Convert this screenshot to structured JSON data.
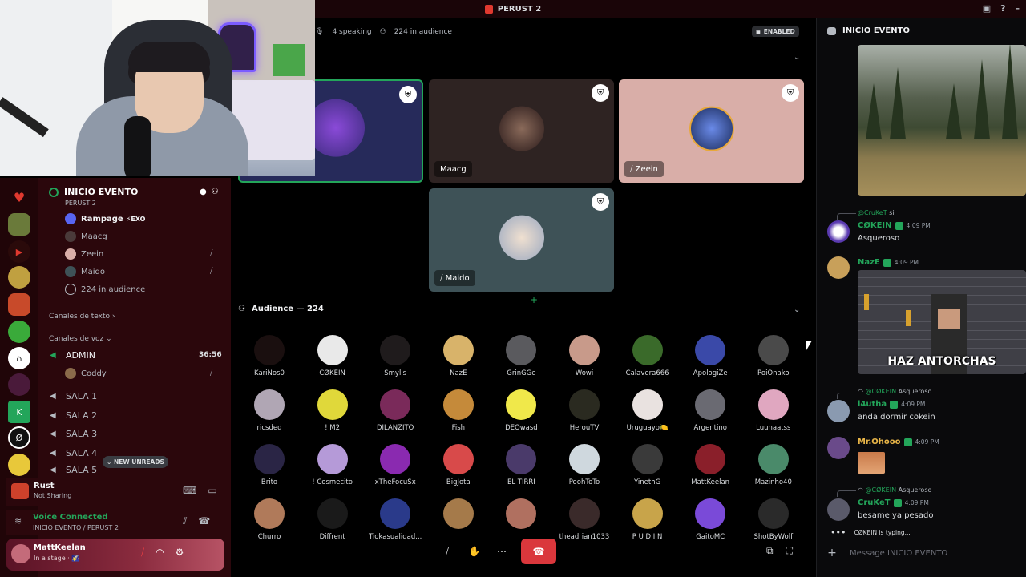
{
  "window": {
    "title": "PERUST 2",
    "accent": "#e0392f"
  },
  "stage": {
    "speaking": "4 speaking",
    "audience_count": "224 in audience",
    "status_badge": "ENABLED",
    "speakers": [
      {
        "name": "Rampage",
        "label": "",
        "bg": "#262a5a",
        "highlight": true
      },
      {
        "name": "Maacg",
        "label": "Maacg",
        "bg": "#2e2322"
      },
      {
        "name": "Zeein",
        "label": "Zeein",
        "bg": "#d9aea8",
        "muted": true
      },
      {
        "name": "Maido",
        "label": "Maido",
        "bg": "#3e5257",
        "muted": true
      }
    ],
    "audience_header": "Audience — 224",
    "audience": [
      {
        "name": "KariÑos0",
        "color": "#1a0f0f"
      },
      {
        "name": "CØKEIN",
        "color": "#e9e9e9"
      },
      {
        "name": "Smylls",
        "color": "#1f1b1c"
      },
      {
        "name": "NazE",
        "color": "#d8b36a"
      },
      {
        "name": "GrinGGe",
        "color": "#5a5a5e"
      },
      {
        "name": "Wowi",
        "color": "#c89a8a"
      },
      {
        "name": "Calavera666",
        "color": "#3a6a2a"
      },
      {
        "name": "ApologiZe",
        "color": "#3a49a8"
      },
      {
        "name": "PoiOnako",
        "color": "#4a4a4a"
      },
      {
        "name": "ricsded",
        "color": "#b0a6b4"
      },
      {
        "name": "! M2",
        "color": "#e0d83a"
      },
      {
        "name": "DILANZITO",
        "color": "#7a2a5a"
      },
      {
        "name": "Fish",
        "color": "#c58a3a"
      },
      {
        "name": "DEOwasd",
        "color": "#f0e84a"
      },
      {
        "name": "HerouTV",
        "color": "#2a2a20"
      },
      {
        "name": "Uruguayo🍋",
        "color": "#e9e2e0"
      },
      {
        "name": "Argentino",
        "color": "#6a6a72"
      },
      {
        "name": "Luunaatss",
        "color": "#e0a7c0"
      },
      {
        "name": "Brito",
        "color": "#2a2545"
      },
      {
        "name": "! Cosmecito",
        "color": "#b59ad8"
      },
      {
        "name": "xTheFocuSx",
        "color": "#8a2ab0"
      },
      {
        "name": "BigJota",
        "color": "#d84a4a"
      },
      {
        "name": "EL TIRRI",
        "color": "#4a3a6a"
      },
      {
        "name": "PoohToTo",
        "color": "#cfd8de"
      },
      {
        "name": "YinethG",
        "color": "#3a3a3a"
      },
      {
        "name": "MattKeelan",
        "color": "#8a1f2a"
      },
      {
        "name": "Mazinho40",
        "color": "#4a8a6a"
      },
      {
        "name": "Churro",
        "color": "#b07a5a"
      },
      {
        "name": "Diffrent",
        "color": "#1a1a1a"
      },
      {
        "name": "Tiokasualidad...",
        "color": "#2a3a8a"
      },
      {
        "name": "",
        "color": "#a57a4a"
      },
      {
        "name": "",
        "color": "#b07060"
      },
      {
        "name": "theadrian1033",
        "color": "#3a2a2a"
      },
      {
        "name": "P U D Í N",
        "color": "#c8a44a"
      },
      {
        "name": "GaitoMC",
        "color": "#7a4ad8"
      },
      {
        "name": "ShotByWolf",
        "color": "#2a2a2a"
      }
    ]
  },
  "sidebar": {
    "stage_channel": "INICIO EVENTO",
    "stage_sub": "PERUST 2",
    "members": [
      {
        "name": "Rampage",
        "tag": "⚡EXO",
        "color": "#5865f2",
        "bold": true
      },
      {
        "name": "Maacg",
        "color": "#4a3a3a"
      },
      {
        "name": "Zeein",
        "color": "#d9aea8"
      },
      {
        "name": "Maido",
        "color": "#3e5257"
      },
      {
        "name": "224 in audience",
        "color": "#444"
      }
    ],
    "text_category": "Canales de texto",
    "voice_category": "Canales de voz",
    "admin_channel": "ADMIN",
    "admin_timer": "36:56",
    "admin_member": "Coddy",
    "rooms": [
      "SALA 1",
      "SALA 2",
      "SALA 3",
      "SALA 4",
      "SALA 5"
    ],
    "new_unreads": "NEW UNREADS"
  },
  "activity": {
    "game": "Rust",
    "status": "Not Sharing"
  },
  "voice": {
    "status": "Voice Connected",
    "location": "INICIO EVENTO / PERUST 2"
  },
  "user": {
    "name": "MattKeelan",
    "status": "In a stage · 🌠"
  },
  "chat": {
    "title": "INICIO EVENTO",
    "image_caption": "HAZ ANTORCHAS",
    "messages": [
      {
        "reply_to": "@CruKeT",
        "reply_text": "si",
        "author": "CØKEIN",
        "color": "#23a55a",
        "time": "4:09 PM",
        "body": "Asqueroso"
      },
      {
        "author": "NazE",
        "color": "#23a55a",
        "time": "4:09 PM",
        "body": ""
      },
      {
        "reply_to": "@CØKEIN",
        "reply_text": "Asqueroso",
        "author": "l4utha",
        "color": "#23a55a",
        "time": "4:09 PM",
        "body": "anda dormir cokein"
      },
      {
        "author": "Mr.Ohooo",
        "color": "#e8b548",
        "time": "4:09 PM",
        "body": ""
      },
      {
        "reply_to": "@CØKEIN",
        "reply_text": "Asqueroso",
        "author": "CruKeT",
        "color": "#23a55a",
        "time": "4:09 PM",
        "body": "besame ya pesado"
      }
    ],
    "typing": "CØKEIN is typing...",
    "placeholder": "Message INICIO EVENTO"
  }
}
